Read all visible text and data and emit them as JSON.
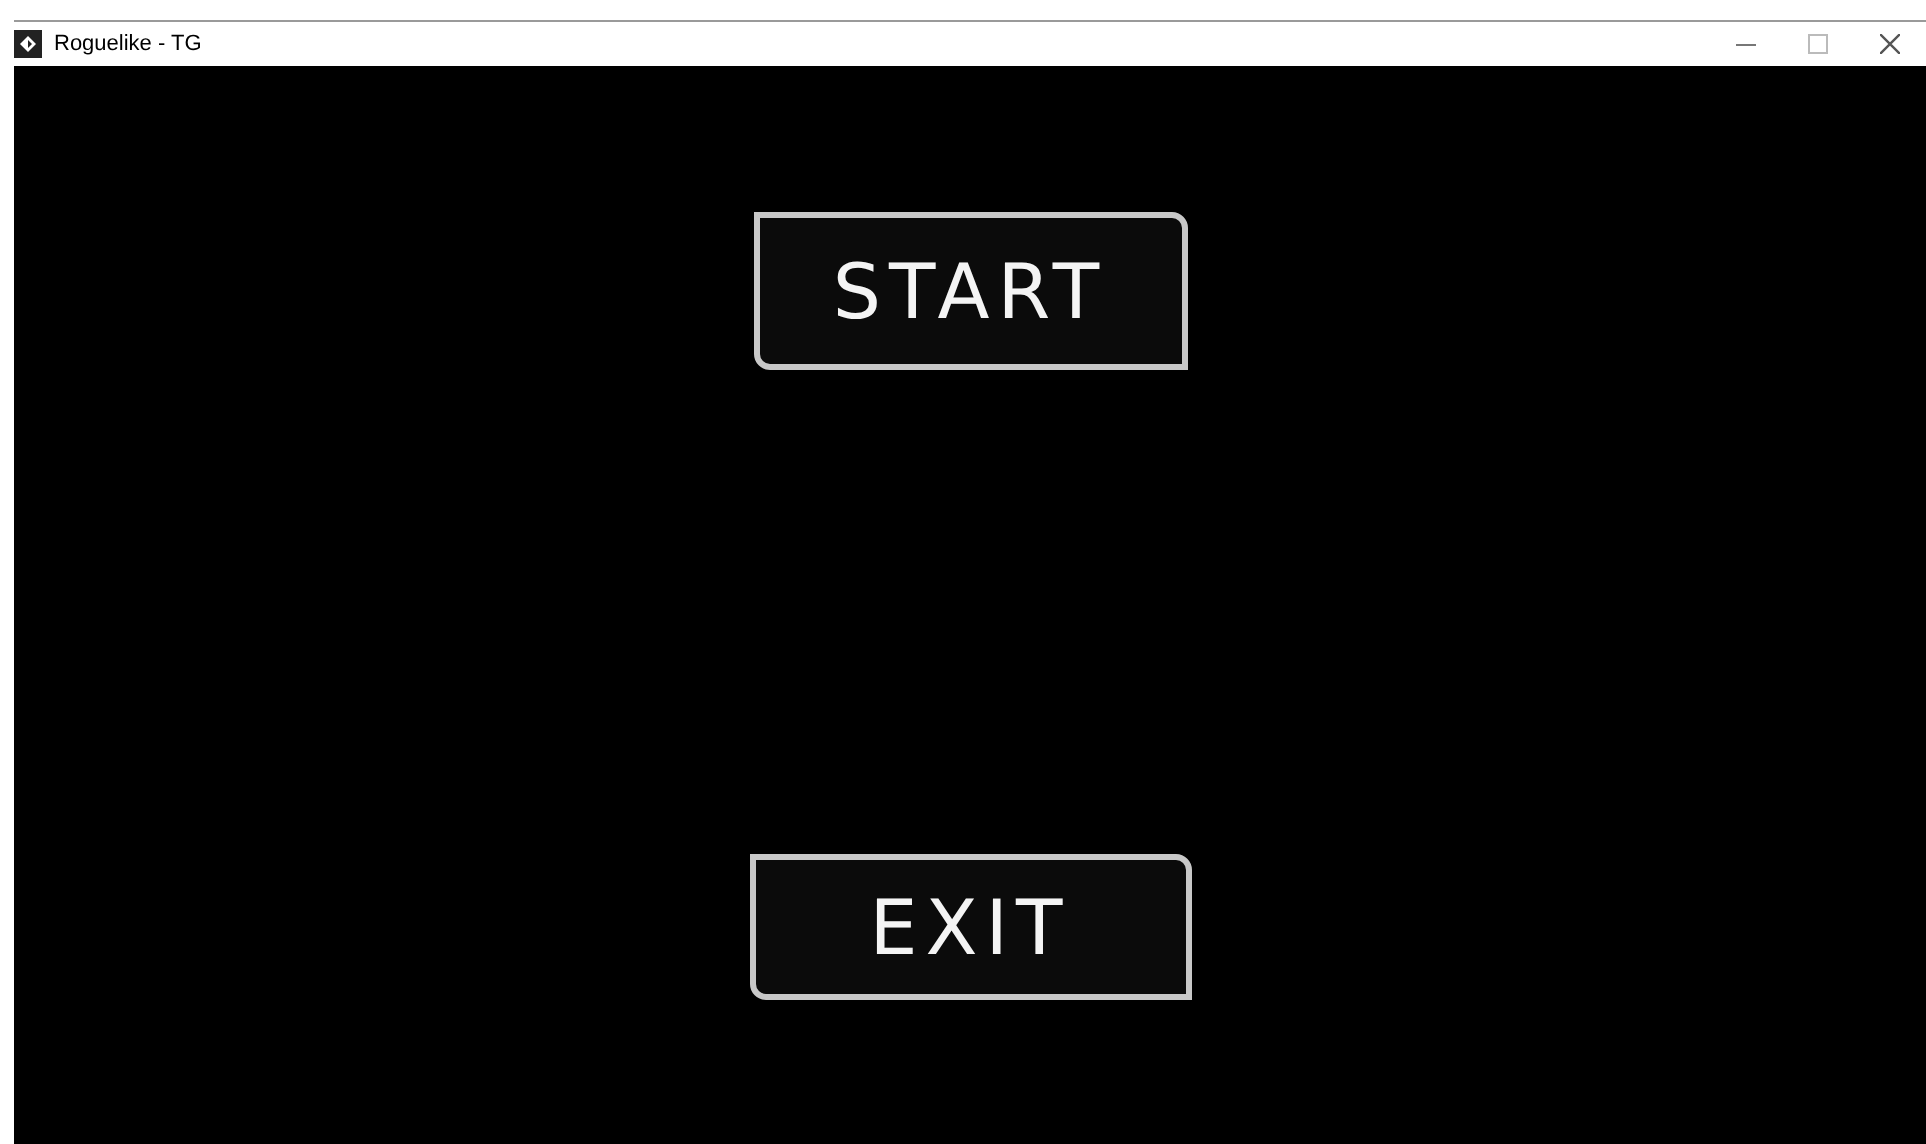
{
  "window": {
    "title": "Roguelike - TG"
  },
  "menu": {
    "buttons": [
      {
        "label": "START"
      },
      {
        "label": "EXIT"
      }
    ]
  }
}
